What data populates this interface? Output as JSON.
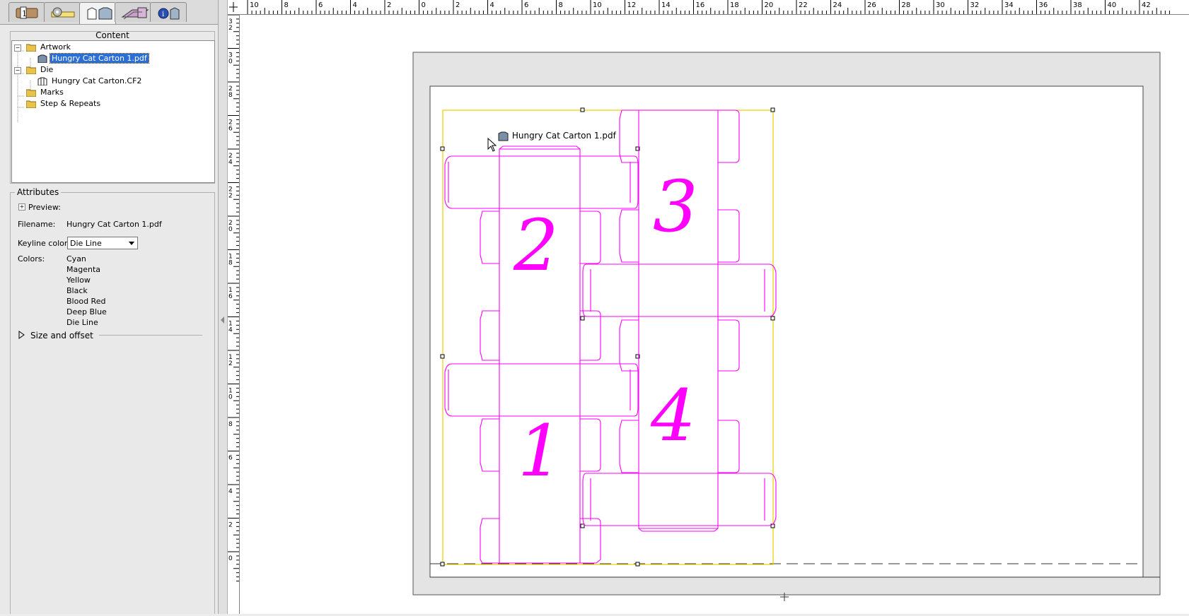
{
  "tabs": [
    {
      "name": "job-info-tab",
      "icon": "job-info-icon"
    },
    {
      "name": "marks-tab",
      "icon": "tape-marks-icon"
    },
    {
      "name": "content-tab",
      "icon": "artwork-cartons-icon"
    },
    {
      "name": "press-sheet-tab",
      "icon": "press-sheet-icon"
    },
    {
      "name": "info-tab",
      "icon": "info-cartons-icon"
    }
  ],
  "content_panel": {
    "title": "Content",
    "tree": [
      {
        "label": "Artwork",
        "level": 0,
        "type": "folder",
        "expanded": true
      },
      {
        "label": "Hungry Cat Carton 1.pdf",
        "level": 1,
        "type": "artwork",
        "selected": true
      },
      {
        "label": "Die",
        "level": 0,
        "type": "folder",
        "expanded": true
      },
      {
        "label": "Hungry Cat Carton.CF2",
        "level": 1,
        "type": "die"
      },
      {
        "label": "Marks",
        "level": 0,
        "type": "folder"
      },
      {
        "label": "Step & Repeats",
        "level": 0,
        "type": "folder"
      }
    ]
  },
  "attributes_panel": {
    "title": "Attributes",
    "preview_label": "Preview:",
    "filename_label": "Filename:",
    "filename_value": "Hungry Cat Carton 1.pdf",
    "keyline_label": "Keyline color:",
    "keyline_value": "Die Line",
    "colors_label": "Colors:",
    "colors": [
      "Cyan",
      "Magenta",
      "Yellow",
      "Black",
      "Blood Red",
      "Deep Blue",
      "Die Line"
    ],
    "size_offset_label": "Size and offset"
  },
  "canvas": {
    "artwork_label": "Hungry Cat Carton 1.pdf",
    "carton_numbers": [
      "1",
      "2",
      "3",
      "4"
    ],
    "die_color": "#ff00ff",
    "bounds_color": "#e8d000"
  },
  "rulers": {
    "top_labels": [
      "10",
      "8",
      "6",
      "4",
      "2",
      "0",
      "2",
      "4",
      "6",
      "8",
      "10",
      "12",
      "14",
      "16",
      "18",
      "20",
      "22",
      "24",
      "26",
      "28",
      "30",
      "32",
      "34",
      "36",
      "38",
      "40",
      "42"
    ],
    "left_labels": [
      "32",
      "30",
      "28",
      "26",
      "24",
      "22",
      "20",
      "18",
      "16",
      "14",
      "12",
      "10",
      "8",
      "6",
      "4",
      "2",
      "0"
    ]
  }
}
